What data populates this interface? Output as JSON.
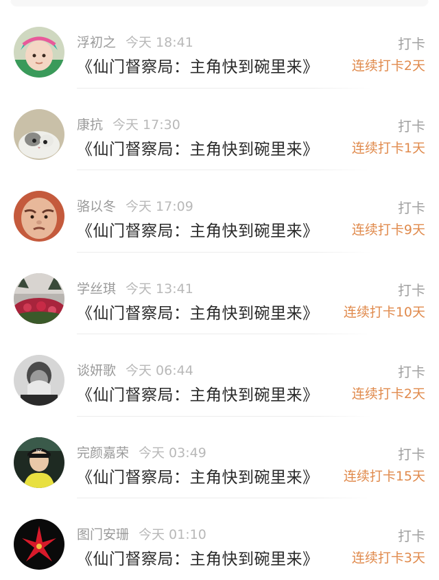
{
  "feed": [
    {
      "name": "浮初之",
      "time": "今天 18:41",
      "book": "《仙门督察局：主角快到碗里来》",
      "action": "打卡",
      "streak": "连续打卡2天",
      "avatar": "avatar-girl-hat-icon"
    },
    {
      "name": "康抗",
      "time": "今天 17:30",
      "book": "《仙门督察局：主角快到碗里来》",
      "action": "打卡",
      "streak": "连续打卡1天",
      "avatar": "avatar-cat-icon"
    },
    {
      "name": "骆以冬",
      "time": "今天 17:09",
      "book": "《仙门督察局：主角快到碗里来》",
      "action": "打卡",
      "streak": "连续打卡9天",
      "avatar": "avatar-baby-icon"
    },
    {
      "name": "学丝琪",
      "time": "今天 13:41",
      "book": "《仙门督察局：主角快到碗里来》",
      "action": "打卡",
      "streak": "连续打卡10天",
      "avatar": "avatar-flowers-icon"
    },
    {
      "name": "谈妍歌",
      "time": "今天 06:44",
      "book": "《仙门督察局：主角快到碗里来》",
      "action": "打卡",
      "streak": "连续打卡2天",
      "avatar": "avatar-bw-person-icon"
    },
    {
      "name": "完颜嘉荣",
      "time": "今天 03:49",
      "book": "《仙门督察局：主角快到碗里来》",
      "action": "打卡",
      "streak": "连续打卡15天",
      "avatar": "avatar-cap-person-icon"
    },
    {
      "name": "图门安珊",
      "time": "今天 01:10",
      "book": "《仙门督察局：主角快到碗里来》",
      "action": "打卡",
      "streak": "连续打卡3天",
      "avatar": "avatar-red-flower-icon"
    }
  ],
  "colors": {
    "accent_streak": "#e08a4c",
    "name": "#9a9a9a",
    "title": "#2a2a2a"
  }
}
